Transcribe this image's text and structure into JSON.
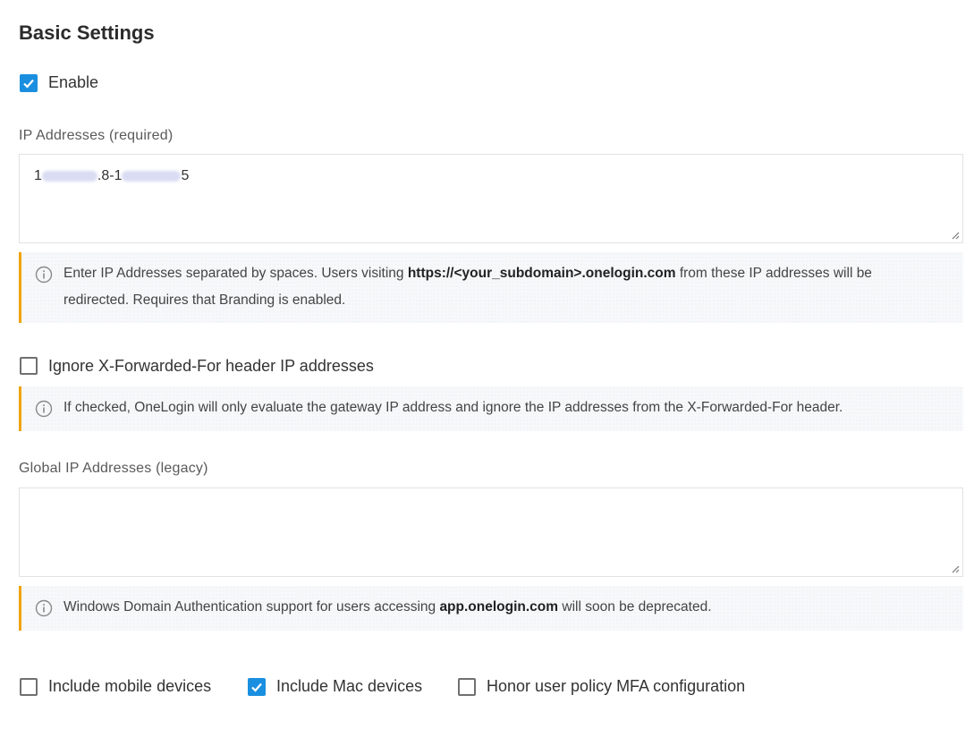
{
  "section": {
    "title": "Basic Settings"
  },
  "enable": {
    "label": "Enable",
    "checked": true
  },
  "ip_addresses": {
    "label": "IP Addresses (required)",
    "value_prefix": "1",
    "value_mid": ".8-1",
    "value_suffix": "5"
  },
  "ip_note": {
    "text_before": "Enter IP Addresses separated by spaces. Users visiting ",
    "bold": "https://<your_subdomain>.onelogin.com",
    "text_after": " from these IP addresses will be",
    "line2": "redirected. Requires that Branding is enabled."
  },
  "ignore_xff": {
    "label": "Ignore X-Forwarded-For header IP addresses",
    "checked": false
  },
  "xff_note": {
    "text": "If checked, OneLogin will only evaluate the gateway IP address and ignore the IP addresses from the X-Forwarded-For header."
  },
  "global_ip": {
    "label": "Global IP Addresses (legacy)",
    "value": ""
  },
  "windows_note": {
    "text_before": "Windows Domain Authentication support for users accessing ",
    "bold": "app.onelogin.com",
    "text_after": " will soon be deprecated."
  },
  "options": [
    {
      "label": "Include mobile devices",
      "checked": false
    },
    {
      "label": "Include Mac devices",
      "checked": true
    },
    {
      "label": "Honor user policy MFA configuration",
      "checked": false
    }
  ],
  "colors": {
    "accent": "#1a8fe0",
    "note_border": "#f0a30a"
  },
  "icons": {
    "info": "info-circle-icon",
    "check": "checkmark-icon",
    "resize": "resize-handle-icon"
  }
}
